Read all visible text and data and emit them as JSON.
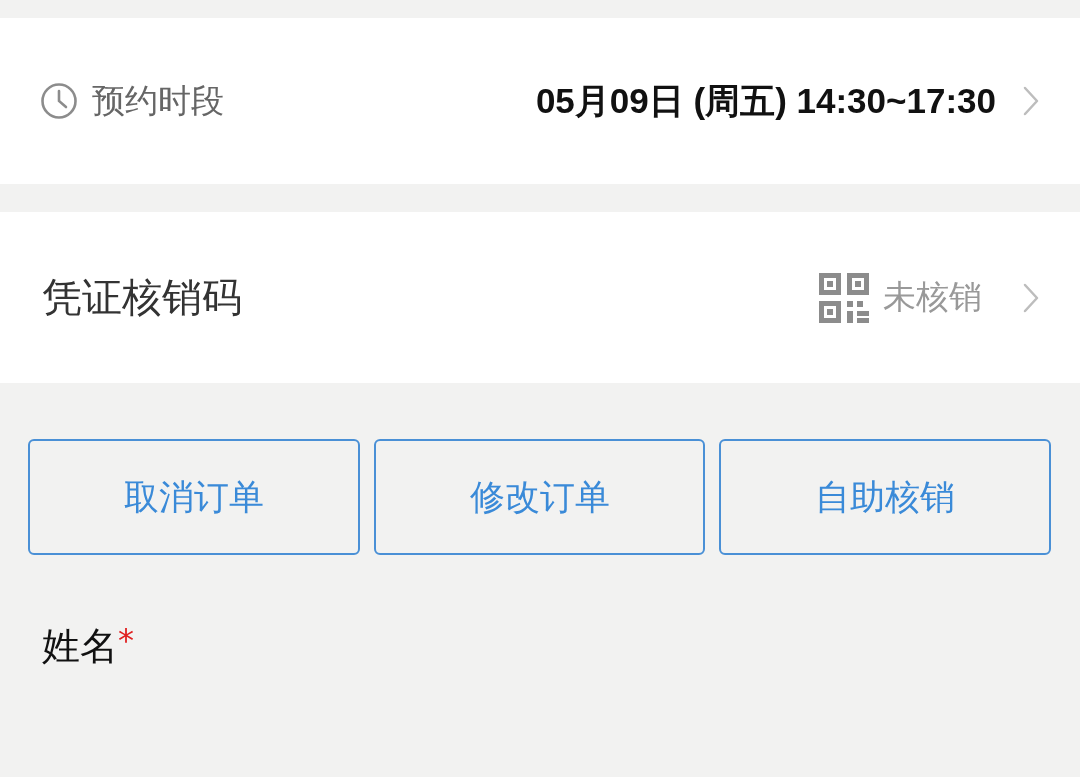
{
  "appointment": {
    "label": "预约时段",
    "value": "05月09日 (周五) 14:30~17:30"
  },
  "voucher": {
    "label": "凭证核销码",
    "status": "未核销"
  },
  "buttons": [
    "取消订单",
    "修改订单",
    "自助核销"
  ],
  "form": {
    "fields": [
      {
        "label": "姓名",
        "required_mark": "*"
      }
    ]
  }
}
